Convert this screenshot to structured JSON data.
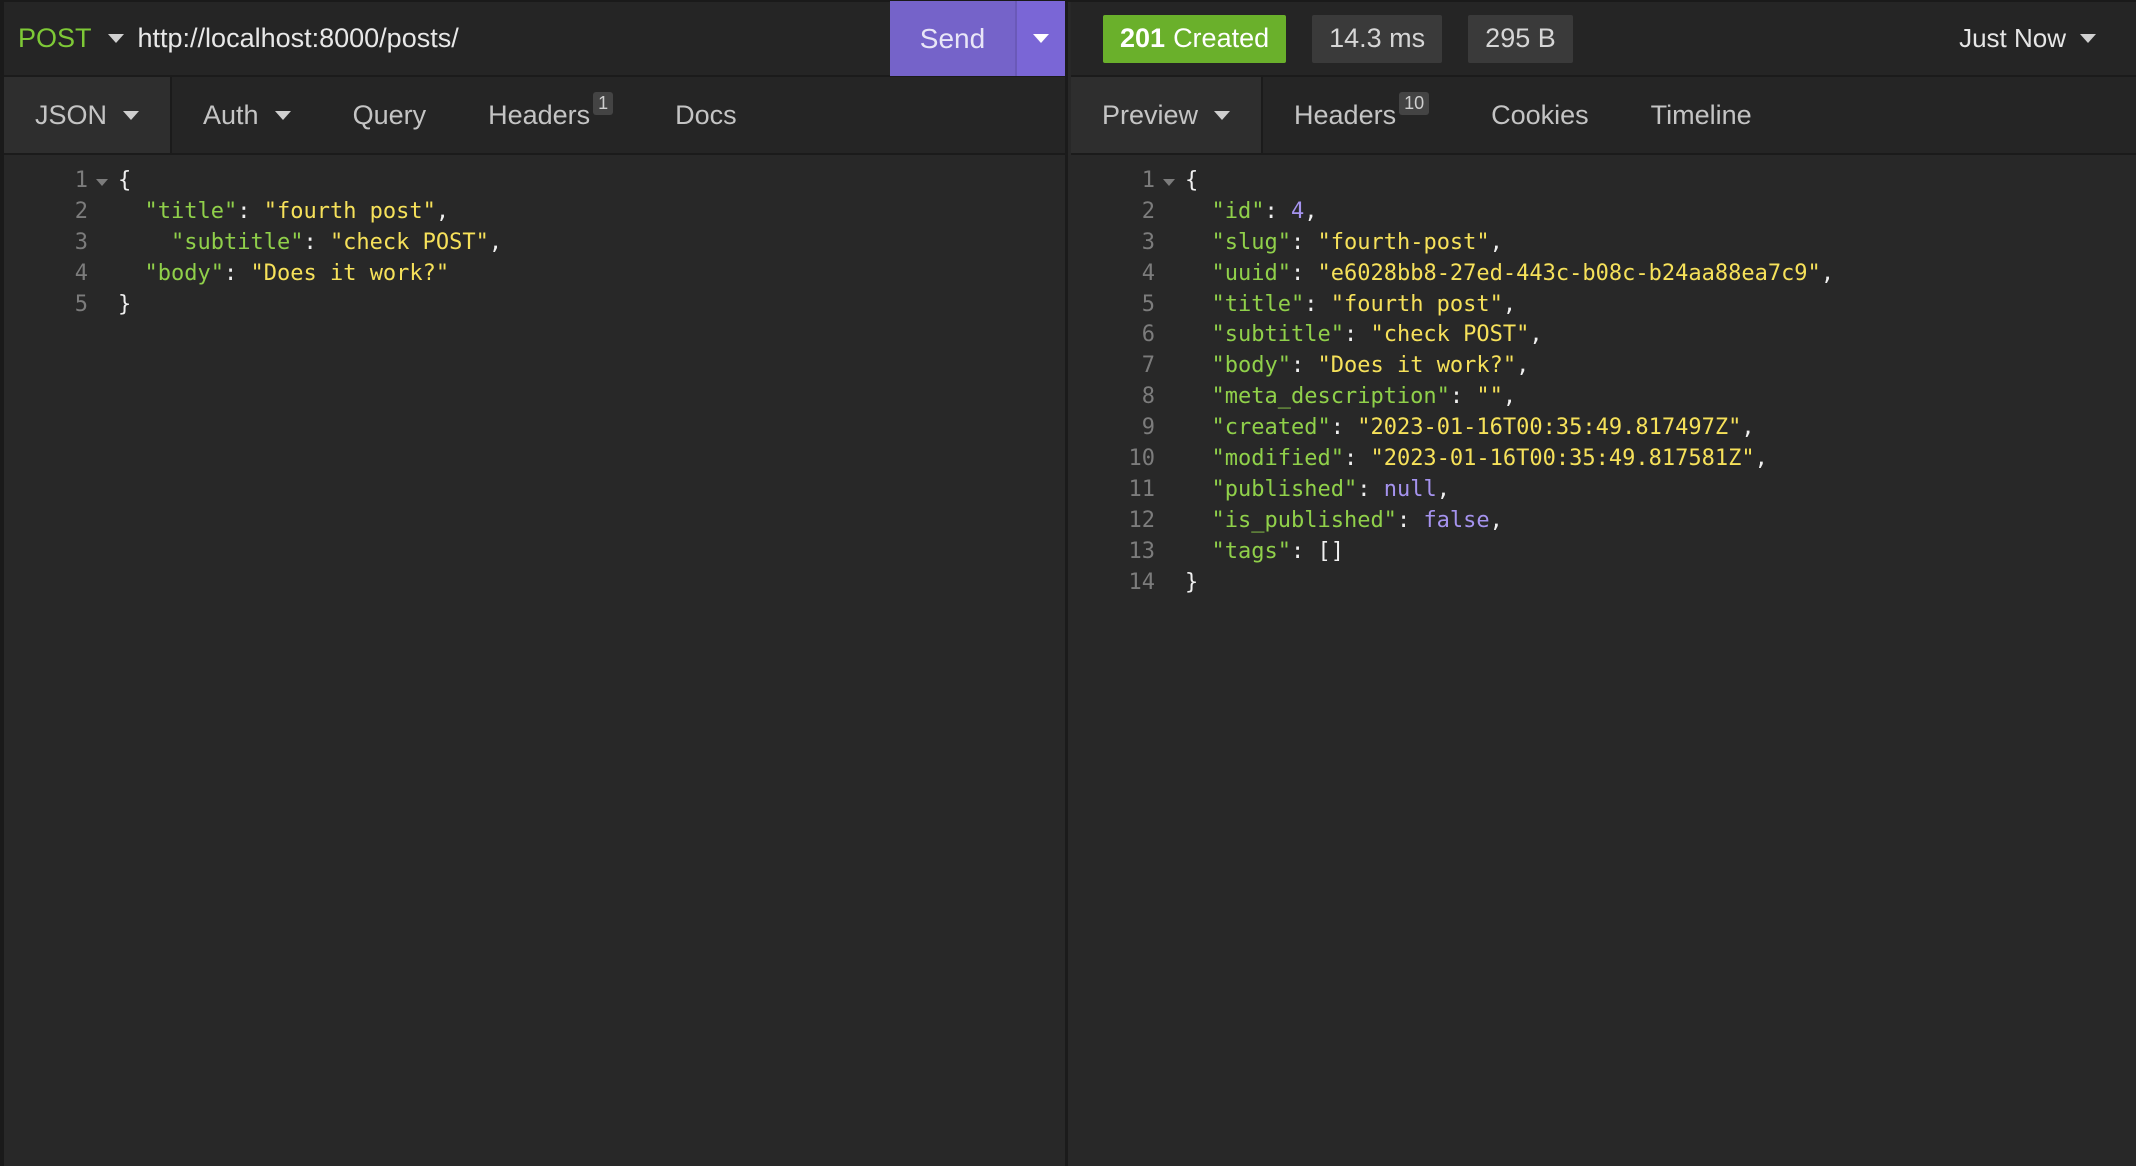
{
  "request": {
    "method": "POST",
    "url": "http://localhost:8000/posts/",
    "send_label": "Send",
    "tabs": [
      {
        "label": "JSON",
        "active": true,
        "dropdown": true
      },
      {
        "label": "Auth",
        "dropdown": true
      },
      {
        "label": "Query"
      },
      {
        "label": "Headers",
        "badge": "1"
      },
      {
        "label": "Docs"
      }
    ],
    "body_lines": [
      {
        "n": "1",
        "fold": true,
        "tokens": [
          {
            "t": "p",
            "v": "{"
          }
        ]
      },
      {
        "n": "2",
        "tokens": [
          {
            "t": "p",
            "v": "  "
          },
          {
            "t": "k",
            "v": "\"title\""
          },
          {
            "t": "p",
            "v": ": "
          },
          {
            "t": "s",
            "v": "\"fourth post\""
          },
          {
            "t": "p",
            "v": ","
          }
        ]
      },
      {
        "n": "3",
        "tokens": [
          {
            "t": "p",
            "v": "    "
          },
          {
            "t": "k",
            "v": "\"subtitle\""
          },
          {
            "t": "p",
            "v": ": "
          },
          {
            "t": "s",
            "v": "\"check POST\""
          },
          {
            "t": "p",
            "v": ","
          }
        ]
      },
      {
        "n": "4",
        "tokens": [
          {
            "t": "p",
            "v": "  "
          },
          {
            "t": "k",
            "v": "\"body\""
          },
          {
            "t": "p",
            "v": ": "
          },
          {
            "t": "s",
            "v": "\"Does it work?\""
          }
        ]
      },
      {
        "n": "5",
        "tokens": [
          {
            "t": "p",
            "v": "}"
          }
        ]
      }
    ]
  },
  "response": {
    "status_code": "201",
    "status_text": "Created",
    "time": "14.3 ms",
    "size": "295 B",
    "history_label": "Just Now",
    "colors": {
      "status": "#6ab02b",
      "send": "#7563c9"
    },
    "tabs": [
      {
        "label": "Preview",
        "active": true,
        "dropdown": true
      },
      {
        "label": "Headers",
        "badge": "10"
      },
      {
        "label": "Cookies"
      },
      {
        "label": "Timeline"
      }
    ],
    "body_lines": [
      {
        "n": "1",
        "fold": true,
        "tokens": [
          {
            "t": "p",
            "v": "{"
          }
        ]
      },
      {
        "n": "2",
        "tokens": [
          {
            "t": "p",
            "v": "  "
          },
          {
            "t": "k",
            "v": "\"id\""
          },
          {
            "t": "p",
            "v": ": "
          },
          {
            "t": "n",
            "v": "4"
          },
          {
            "t": "p",
            "v": ","
          }
        ]
      },
      {
        "n": "3",
        "tokens": [
          {
            "t": "p",
            "v": "  "
          },
          {
            "t": "k",
            "v": "\"slug\""
          },
          {
            "t": "p",
            "v": ": "
          },
          {
            "t": "s",
            "v": "\"fourth-post\""
          },
          {
            "t": "p",
            "v": ","
          }
        ]
      },
      {
        "n": "4",
        "tokens": [
          {
            "t": "p",
            "v": "  "
          },
          {
            "t": "k",
            "v": "\"uuid\""
          },
          {
            "t": "p",
            "v": ": "
          },
          {
            "t": "s",
            "v": "\"e6028bb8-27ed-443c-b08c-b24aa88ea7c9\""
          },
          {
            "t": "p",
            "v": ","
          }
        ]
      },
      {
        "n": "5",
        "tokens": [
          {
            "t": "p",
            "v": "  "
          },
          {
            "t": "k",
            "v": "\"title\""
          },
          {
            "t": "p",
            "v": ": "
          },
          {
            "t": "s",
            "v": "\"fourth post\""
          },
          {
            "t": "p",
            "v": ","
          }
        ]
      },
      {
        "n": "6",
        "tokens": [
          {
            "t": "p",
            "v": "  "
          },
          {
            "t": "k",
            "v": "\"subtitle\""
          },
          {
            "t": "p",
            "v": ": "
          },
          {
            "t": "s",
            "v": "\"check POST\""
          },
          {
            "t": "p",
            "v": ","
          }
        ]
      },
      {
        "n": "7",
        "tokens": [
          {
            "t": "p",
            "v": "  "
          },
          {
            "t": "k",
            "v": "\"body\""
          },
          {
            "t": "p",
            "v": ": "
          },
          {
            "t": "s",
            "v": "\"Does it work?\""
          },
          {
            "t": "p",
            "v": ","
          }
        ]
      },
      {
        "n": "8",
        "tokens": [
          {
            "t": "p",
            "v": "  "
          },
          {
            "t": "k",
            "v": "\"meta_description\""
          },
          {
            "t": "p",
            "v": ": "
          },
          {
            "t": "s",
            "v": "\"\""
          },
          {
            "t": "p",
            "v": ","
          }
        ]
      },
      {
        "n": "9",
        "tokens": [
          {
            "t": "p",
            "v": "  "
          },
          {
            "t": "k",
            "v": "\"created\""
          },
          {
            "t": "p",
            "v": ": "
          },
          {
            "t": "s",
            "v": "\"2023-01-16T00:35:49.817497Z\""
          },
          {
            "t": "p",
            "v": ","
          }
        ]
      },
      {
        "n": "10",
        "tokens": [
          {
            "t": "p",
            "v": "  "
          },
          {
            "t": "k",
            "v": "\"modified\""
          },
          {
            "t": "p",
            "v": ": "
          },
          {
            "t": "s",
            "v": "\"2023-01-16T00:35:49.817581Z\""
          },
          {
            "t": "p",
            "v": ","
          }
        ]
      },
      {
        "n": "11",
        "tokens": [
          {
            "t": "p",
            "v": "  "
          },
          {
            "t": "k",
            "v": "\"published\""
          },
          {
            "t": "p",
            "v": ": "
          },
          {
            "t": "n",
            "v": "null"
          },
          {
            "t": "p",
            "v": ","
          }
        ]
      },
      {
        "n": "12",
        "tokens": [
          {
            "t": "p",
            "v": "  "
          },
          {
            "t": "k",
            "v": "\"is_published\""
          },
          {
            "t": "p",
            "v": ": "
          },
          {
            "t": "n",
            "v": "false"
          },
          {
            "t": "p",
            "v": ","
          }
        ]
      },
      {
        "n": "13",
        "tokens": [
          {
            "t": "p",
            "v": "  "
          },
          {
            "t": "k",
            "v": "\"tags\""
          },
          {
            "t": "p",
            "v": ": []"
          }
        ]
      },
      {
        "n": "14",
        "tokens": [
          {
            "t": "p",
            "v": "}"
          }
        ]
      }
    ]
  }
}
